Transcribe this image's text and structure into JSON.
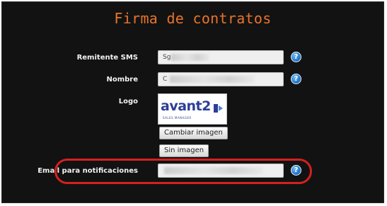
{
  "page": {
    "title": "Firma de contratos"
  },
  "form": {
    "sender_sms": {
      "label": "Remitente SMS",
      "value": "Sg"
    },
    "name": {
      "label": "Nombre",
      "value": "C"
    },
    "logo": {
      "label": "Logo",
      "brand_text": "avant2",
      "brand_subtext": "SALES MANAGER",
      "change_button": "Cambiar imagen",
      "remove_button": "Sin imagen"
    },
    "notification_email": {
      "label": "Email para notificaciones",
      "value": ""
    }
  },
  "help_icon": {
    "glyph": "?",
    "icon": "help-question-icon",
    "color": "#1b6fc2"
  },
  "colors": {
    "title": "#e8742a",
    "highlight": "#d62020",
    "brand": "#2d3e96"
  }
}
